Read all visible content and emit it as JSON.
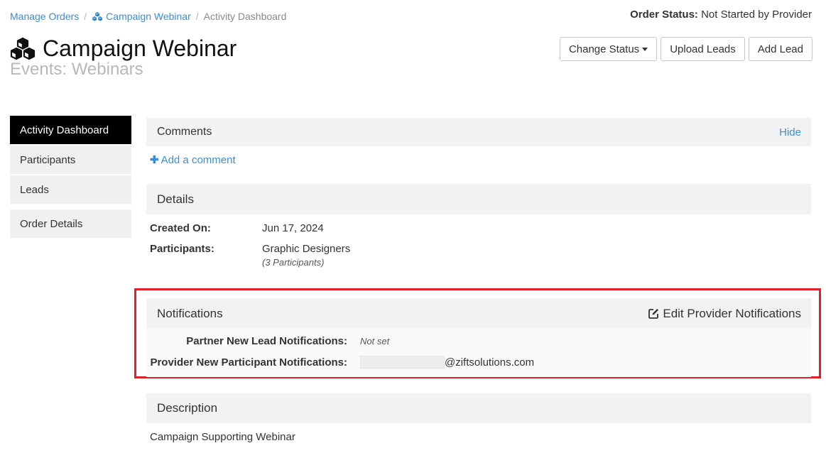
{
  "breadcrumb": {
    "manage_orders": "Manage Orders",
    "campaign": "Campaign Webinar",
    "current": "Activity Dashboard",
    "separator": "/"
  },
  "order_status": {
    "label": "Order Status:",
    "value": "Not Started by Provider"
  },
  "title": "Campaign Webinar",
  "subtitle": "Events: Webinars",
  "actions": {
    "change_status": "Change Status",
    "upload_leads": "Upload Leads",
    "add_lead": "Add Lead"
  },
  "sidebar": {
    "items": [
      {
        "label": "Activity Dashboard",
        "active": true
      },
      {
        "label": "Participants"
      },
      {
        "label": "Leads"
      },
      {
        "label": "Order Details"
      }
    ]
  },
  "comments": {
    "title": "Comments",
    "hide": "Hide",
    "add": "Add a comment"
  },
  "details": {
    "title": "Details",
    "created_label": "Created On:",
    "created_value": "Jun 17, 2024",
    "participants_label": "Participants:",
    "participants_value": "Graphic Designers",
    "participants_count": "(3 Participants)"
  },
  "notifications": {
    "title": "Notifications",
    "edit": "Edit Provider Notifications",
    "partner_label": "Partner New Lead Notifications:",
    "partner_value": "Not set",
    "provider_label": "Provider New Participant Notifications:",
    "provider_value": "@ziftsolutions.com"
  },
  "description": {
    "title": "Description",
    "text": "Campaign Supporting Webinar"
  },
  "colors": {
    "link": "#3a8fd6",
    "highlight_border": "#e0202b",
    "active_sidebar": "#000000"
  },
  "icons": [
    "cubes-icon",
    "caret-down-icon",
    "plus-icon",
    "edit-icon"
  ]
}
